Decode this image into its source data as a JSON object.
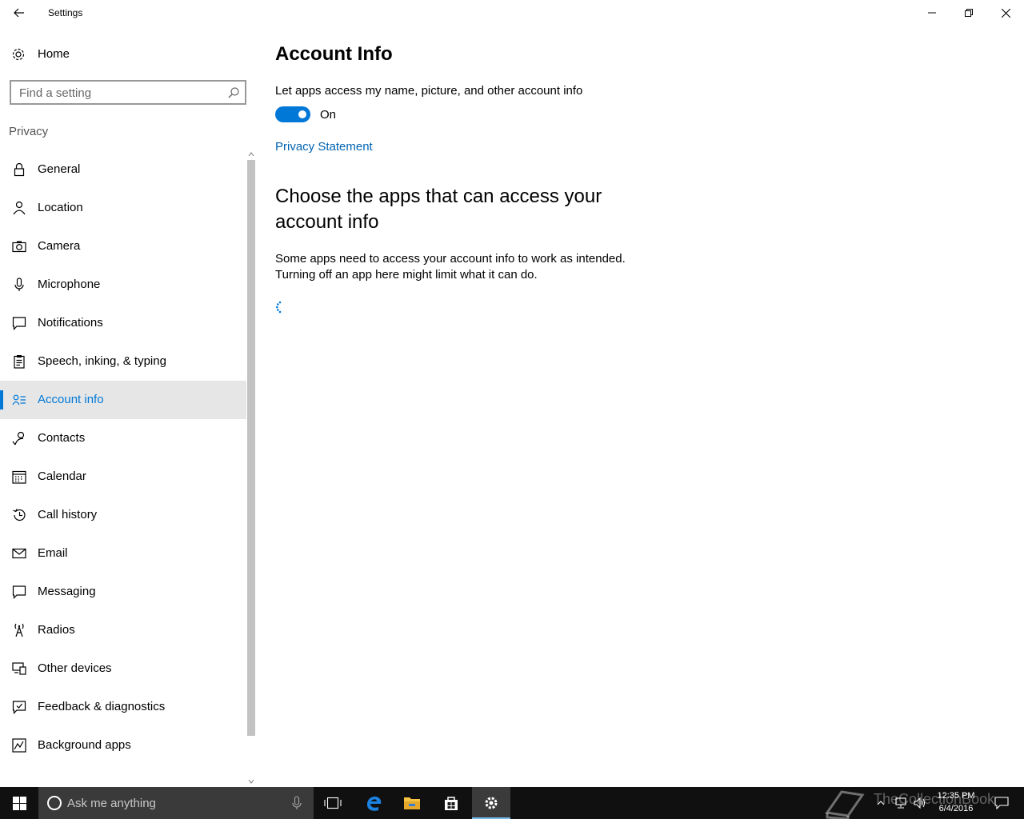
{
  "window": {
    "title": "Settings"
  },
  "sidebar": {
    "home_label": "Home",
    "search_placeholder": "Find a setting",
    "section_label": "Privacy",
    "items": [
      {
        "label": "General",
        "icon": "lock-icon"
      },
      {
        "label": "Location",
        "icon": "location-person-icon"
      },
      {
        "label": "Camera",
        "icon": "camera-icon"
      },
      {
        "label": "Microphone",
        "icon": "microphone-icon"
      },
      {
        "label": "Notifications",
        "icon": "notification-icon"
      },
      {
        "label": "Speech, inking, & typing",
        "icon": "clipboard-icon"
      },
      {
        "label": "Account info",
        "icon": "account-card-icon",
        "selected": true
      },
      {
        "label": "Contacts",
        "icon": "contacts-icon"
      },
      {
        "label": "Calendar",
        "icon": "calendar-icon"
      },
      {
        "label": "Call history",
        "icon": "history-icon"
      },
      {
        "label": "Email",
        "icon": "mail-icon"
      },
      {
        "label": "Messaging",
        "icon": "message-icon"
      },
      {
        "label": "Radios",
        "icon": "radio-tower-icon"
      },
      {
        "label": "Other devices",
        "icon": "devices-icon"
      },
      {
        "label": "Feedback & diagnostics",
        "icon": "feedback-icon"
      },
      {
        "label": "Background apps",
        "icon": "background-apps-icon"
      }
    ]
  },
  "main": {
    "title": "Account Info",
    "toggle_description": "Let apps access my name, picture, and other account info",
    "toggle_state": "On",
    "toggle_on": true,
    "privacy_link": "Privacy Statement",
    "section_heading": "Choose the apps that can access your account info",
    "section_description": "Some apps need to access your account info to work as intended. Turning off an app here might limit what it can do."
  },
  "taskbar": {
    "search_placeholder": "Ask me anything",
    "apps": [
      "task-view-icon",
      "edge-icon",
      "file-explorer-icon",
      "store-icon",
      "settings-gear-icon"
    ],
    "active_app": "settings-gear-icon",
    "clock_time": "12:35 PM",
    "clock_date": "6/4/2016",
    "watermark": "TheCollectionBook"
  },
  "colors": {
    "accent": "#0078d7",
    "link": "#0063b1",
    "taskbar": "#101010",
    "selected_bg": "#e6e6e6"
  }
}
